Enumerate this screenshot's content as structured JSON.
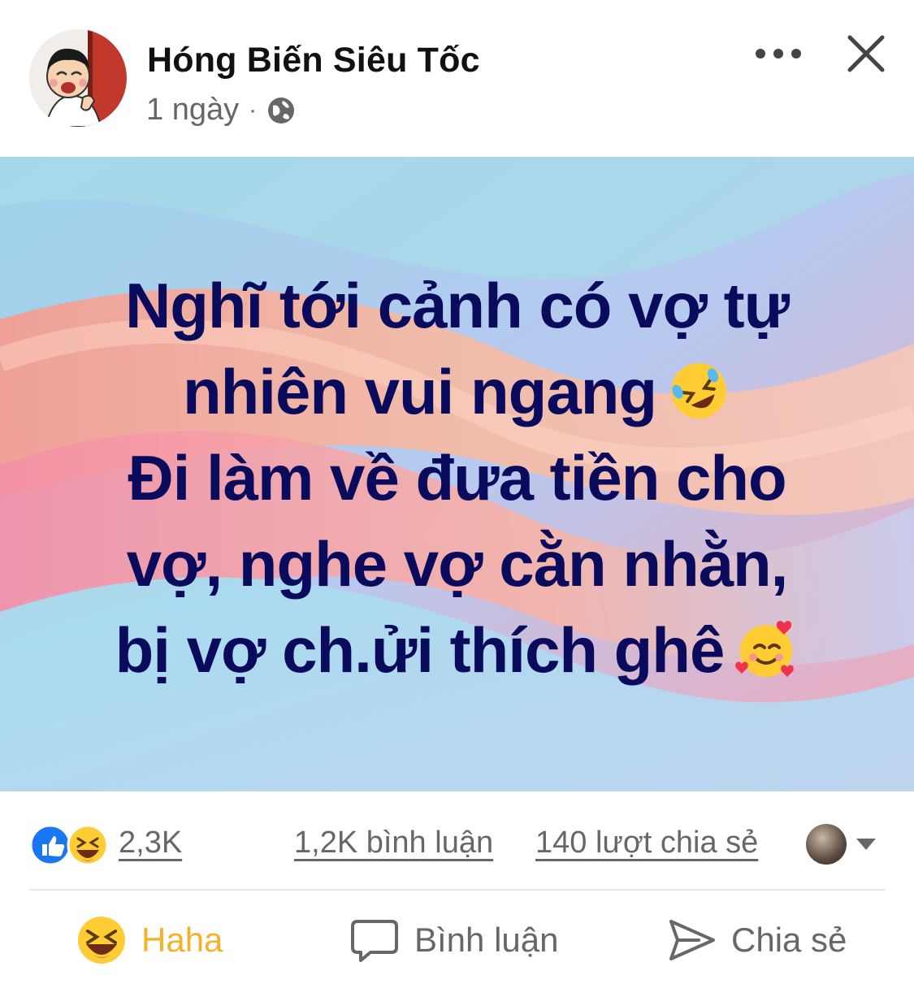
{
  "post": {
    "author": "Hóng Biến Siêu Tốc",
    "time": "1 ngày",
    "separator": "·",
    "privacy_icon": "globe-icon",
    "menu_icon": "more-options-icon",
    "close_icon": "close-icon"
  },
  "content": {
    "lines": [
      "Nghĩ tới cảnh có vợ tự",
      "nhiên vui ngang",
      "Đi làm về đưa tiền cho",
      "vợ, nghe vợ cằn nhằn,",
      "bị vợ ch.ửi thích ghê"
    ],
    "emoji_1": "rolling-on-floor-laughing-emoji",
    "emoji_2": "smiling-face-with-hearts-emoji"
  },
  "stats": {
    "reactions": "2,3K",
    "reaction_icons": [
      "like-icon",
      "haha-icon"
    ],
    "comments": "1,2K bình luận",
    "shares": "140 lượt chia sẻ"
  },
  "actions": {
    "haha_label": "Haha",
    "comment_label": "Bình luận",
    "share_label": "Chia sẻ"
  },
  "colors": {
    "text_primary": "#050505",
    "text_secondary": "#65676b",
    "haha_accent": "#f7b125",
    "like_blue": "#1877f2",
    "post_text": "#0b0b5e"
  }
}
